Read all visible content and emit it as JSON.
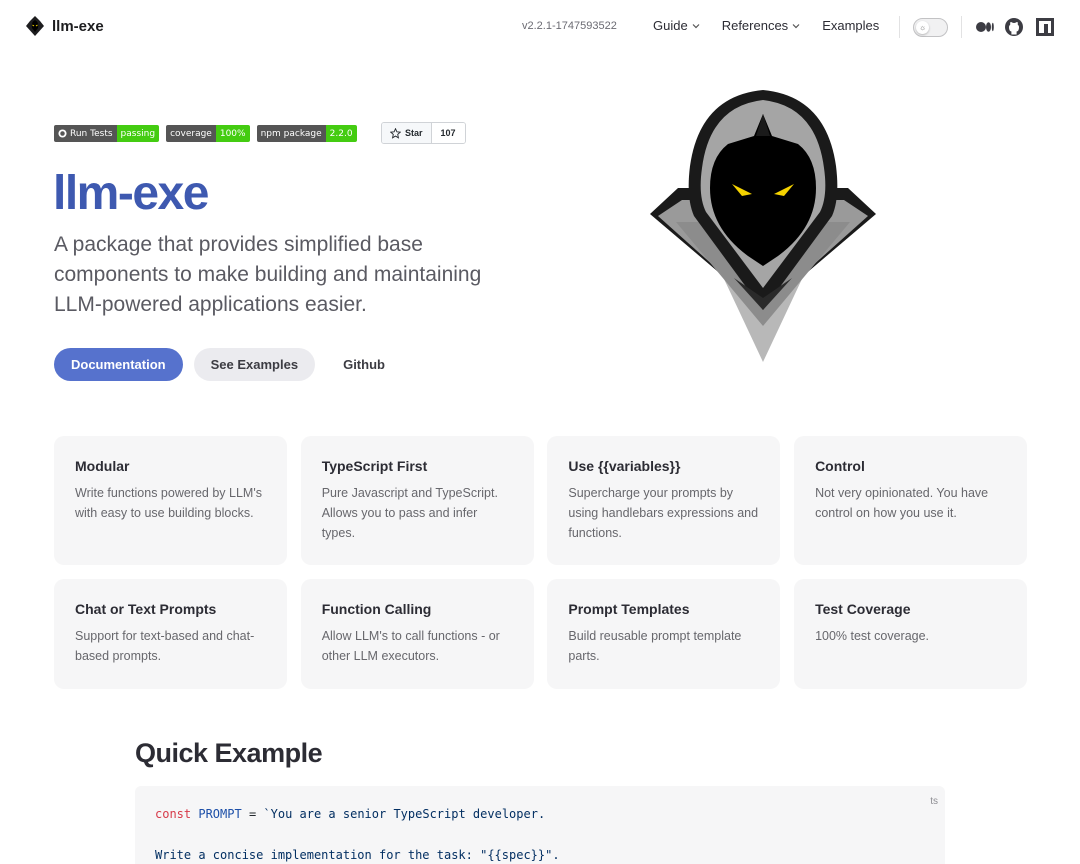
{
  "nav": {
    "brand": "llm-exe",
    "version": "v2.2.1-1747593522",
    "links": [
      {
        "label": "Guide",
        "dropdown": true
      },
      {
        "label": "References",
        "dropdown": true
      },
      {
        "label": "Examples",
        "dropdown": false
      }
    ],
    "social_icons": [
      "medium-icon",
      "github-icon",
      "npm-icon"
    ]
  },
  "hero": {
    "badges": [
      {
        "label": "Run Tests",
        "value": "passing",
        "color": "#44cc11"
      },
      {
        "label": "coverage",
        "value": "100%",
        "color": "#44cc11"
      },
      {
        "label": "npm package",
        "value": "2.2.0",
        "color": "#44cc11"
      }
    ],
    "github_star": {
      "label": "Star",
      "count": "107"
    },
    "name": "llm-exe",
    "tagline": "A package that provides simplified base components to make building and maintaining LLM-powered applications easier.",
    "actions": [
      {
        "label": "Documentation",
        "theme": "brand"
      },
      {
        "label": "See Examples",
        "theme": "alt"
      },
      {
        "label": "Github",
        "theme": "plain"
      }
    ]
  },
  "features": [
    {
      "title": "Modular",
      "details": "Write functions powered by LLM's with easy to use building blocks."
    },
    {
      "title": "TypeScript First",
      "details": "Pure Javascript and TypeScript. Allows you to pass and infer types."
    },
    {
      "title": "Use {{variables}}",
      "details": "Supercharge your prompts by using handlebars expressions and functions."
    },
    {
      "title": "Control",
      "details": "Not very opinionated. You have control on how you use it."
    },
    {
      "title": "Chat or Text Prompts",
      "details": "Support for text-based and chat-based prompts."
    },
    {
      "title": "Function Calling",
      "details": "Allow LLM's to call functions - or other LLM executors."
    },
    {
      "title": "Prompt Templates",
      "details": "Build reusable prompt template parts."
    },
    {
      "title": "Test Coverage",
      "details": "100% test coverage."
    }
  ],
  "quick_example": {
    "title": "Quick Example",
    "lang": "ts",
    "line1": {
      "keyword": "const",
      "name": "PROMPT",
      "op": " = ",
      "text": "`You are a senior TypeScript developer."
    },
    "line2": "Write a concise implementation for the task: \"{{spec}}\"."
  },
  "colors": {
    "brand": "#3e59b0",
    "button": "#5672cd",
    "badge_green": "#44cc11",
    "card_bg": "#f6f6f7"
  }
}
